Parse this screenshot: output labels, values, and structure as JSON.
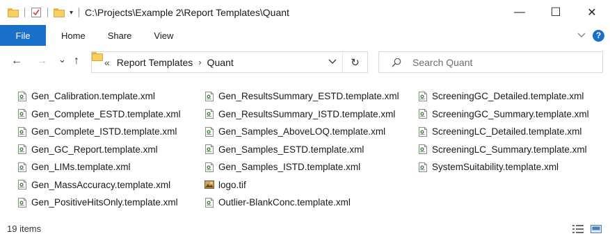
{
  "window": {
    "title": "C:\\Projects\\Example 2\\Report Templates\\Quant",
    "quick_access_dropdown": "▾",
    "controls": {
      "minimize": "—",
      "maximize": "☐",
      "close": "✕"
    }
  },
  "ribbon": {
    "file_tab": "File",
    "tabs": [
      "Home",
      "Share",
      "View"
    ],
    "expand_icon": "chevron-down-icon",
    "help": "?"
  },
  "nav": {
    "back": "←",
    "forward": "→",
    "recent": "⌄",
    "up": "↑"
  },
  "address": {
    "overflow": "«",
    "breadcrumbs": [
      "Report Templates",
      "Quant"
    ],
    "separator": "›",
    "dropdown": "⌄",
    "refresh": "↻"
  },
  "search": {
    "placeholder": "Search Quant"
  },
  "colors": {
    "accent": "#1a6fc9",
    "folder": "#f6cf5f"
  },
  "files": {
    "columns": [
      [
        {
          "name": "Gen_Calibration.template.xml",
          "icon": "xml-file-icon"
        },
        {
          "name": "Gen_Complete_ESTD.template.xml",
          "icon": "xml-file-icon"
        },
        {
          "name": "Gen_Complete_ISTD.template.xml",
          "icon": "xml-file-icon"
        },
        {
          "name": "Gen_GC_Report.template.xml",
          "icon": "xml-file-icon"
        },
        {
          "name": "Gen_LIMs.template.xml",
          "icon": "xml-file-icon"
        },
        {
          "name": "Gen_MassAccuracy.template.xml",
          "icon": "xml-file-icon"
        },
        {
          "name": "Gen_PositiveHitsOnly.template.xml",
          "icon": "xml-file-icon"
        }
      ],
      [
        {
          "name": "Gen_ResultsSummary_ESTD.template.xml",
          "icon": "xml-file-icon"
        },
        {
          "name": "Gen_ResultsSummary_ISTD.template.xml",
          "icon": "xml-file-icon"
        },
        {
          "name": "Gen_Samples_AboveLOQ.template.xml",
          "icon": "xml-file-icon"
        },
        {
          "name": "Gen_Samples_ESTD.template.xml",
          "icon": "xml-file-icon"
        },
        {
          "name": "Gen_Samples_ISTD.template.xml",
          "icon": "xml-file-icon"
        },
        {
          "name": "logo.tif",
          "icon": "image-file-icon"
        },
        {
          "name": "Outlier-BlankConc.template.xml",
          "icon": "xml-file-icon"
        }
      ],
      [
        {
          "name": "ScreeningGC_Detailed.template.xml",
          "icon": "xml-file-icon"
        },
        {
          "name": "ScreeningGC_Summary.template.xml",
          "icon": "xml-file-icon"
        },
        {
          "name": "ScreeningLC_Detailed.template.xml",
          "icon": "xml-file-icon"
        },
        {
          "name": "ScreeningLC_Summary.template.xml",
          "icon": "xml-file-icon"
        },
        {
          "name": "SystemSuitability.template.xml",
          "icon": "xml-file-icon"
        }
      ]
    ]
  },
  "status": {
    "item_count": "19 items",
    "view_icons": [
      "details-view-icon",
      "large-icons-view-icon"
    ]
  }
}
